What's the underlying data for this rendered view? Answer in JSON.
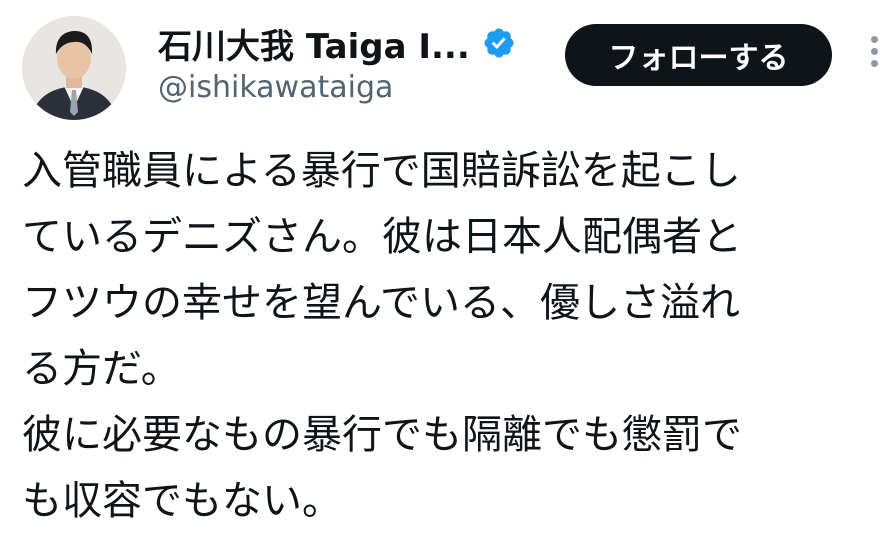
{
  "author": {
    "display_name": "石川大我 Taiga I...",
    "handle": "@ishikawataiga",
    "verified_icon": "verified-badge-icon",
    "avatar_icon": "avatar-photo"
  },
  "actions": {
    "follow_label": "フォローする",
    "more_icon": "more-vertical-icon"
  },
  "tweet": {
    "lines": [
      "入管職員による暴行で国賠訴訟を起こし",
      "ているデニズさん。彼は日本人配偶者と",
      "フツウの幸せを望んでいる、優しさ溢れ",
      "る方だ。",
      "彼に必要なもの暴行でも隔離でも懲罰で",
      "も収容でもない。"
    ]
  },
  "colors": {
    "text": "#0f1419",
    "secondary_text": "#536471",
    "follow_bg": "#0f1419",
    "follow_text": "#ffffff",
    "verified_blue": "#1d9bf0"
  }
}
